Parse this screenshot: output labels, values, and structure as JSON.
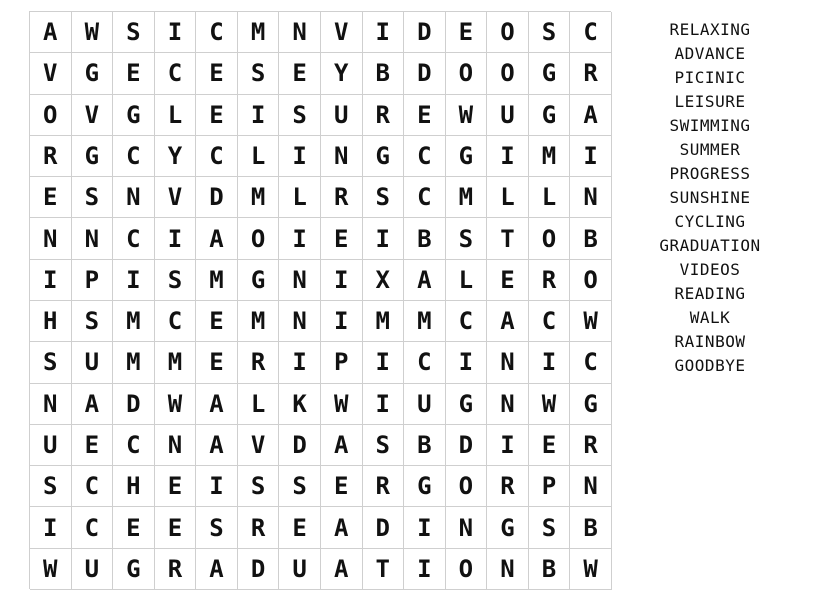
{
  "puzzle": {
    "grid": [
      [
        "A",
        "W",
        "S",
        "I",
        "C",
        "M",
        "N",
        "V",
        "I",
        "D",
        "E",
        "O",
        "S",
        "C"
      ],
      [
        "V",
        "G",
        "E",
        "C",
        "E",
        "S",
        "E",
        "Y",
        "B",
        "D",
        "O",
        "O",
        "G",
        "R"
      ],
      [
        "O",
        "V",
        "G",
        "L",
        "E",
        "I",
        "S",
        "U",
        "R",
        "E",
        "W",
        "U",
        "G",
        "A"
      ],
      [
        "R",
        "G",
        "C",
        "Y",
        "C",
        "L",
        "I",
        "N",
        "G",
        "C",
        "G",
        "I",
        "M",
        "I"
      ],
      [
        "E",
        "S",
        "N",
        "V",
        "D",
        "M",
        "L",
        "R",
        "S",
        "C",
        "M",
        "L",
        "L",
        "N"
      ],
      [
        "N",
        "N",
        "C",
        "I",
        "A",
        "O",
        "I",
        "E",
        "I",
        "B",
        "S",
        "T",
        "O",
        "B"
      ],
      [
        "I",
        "P",
        "I",
        "S",
        "M",
        "G",
        "N",
        "I",
        "X",
        "A",
        "L",
        "E",
        "R",
        "O"
      ],
      [
        "H",
        "S",
        "M",
        "C",
        "E",
        "M",
        "N",
        "I",
        "M",
        "M",
        "C",
        "A",
        "C",
        "W"
      ],
      [
        "S",
        "U",
        "M",
        "M",
        "E",
        "R",
        "I",
        "P",
        "I",
        "C",
        "I",
        "N",
        "I",
        "C"
      ],
      [
        "N",
        "A",
        "D",
        "W",
        "A",
        "L",
        "K",
        "W",
        "I",
        "U",
        "G",
        "N",
        "W",
        "G"
      ],
      [
        "U",
        "E",
        "C",
        "N",
        "A",
        "V",
        "D",
        "A",
        "S",
        "B",
        "D",
        "I",
        "E",
        "R"
      ],
      [
        "S",
        "C",
        "H",
        "E",
        "I",
        "S",
        "S",
        "E",
        "R",
        "G",
        "O",
        "R",
        "P",
        "N"
      ],
      [
        "I",
        "C",
        "E",
        "E",
        "S",
        "R",
        "E",
        "A",
        "D",
        "I",
        "N",
        "G",
        "S",
        "B"
      ],
      [
        "W",
        "U",
        "G",
        "R",
        "A",
        "D",
        "U",
        "A",
        "T",
        "I",
        "O",
        "N",
        "B",
        "W"
      ]
    ],
    "words": [
      "RELAXING",
      "ADVANCE",
      "PICINIC",
      "LEISURE",
      "SWIMMING",
      "SUMMER",
      "PROGRESS",
      "SUNSHINE",
      "CYCLING",
      "GRADUATION",
      "VIDEOS",
      "READING",
      "WALK",
      "RAINBOW",
      "GOODBYE"
    ]
  }
}
